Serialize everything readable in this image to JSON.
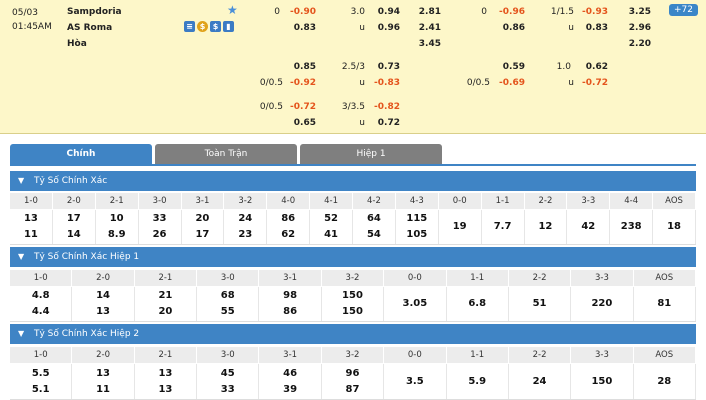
{
  "match": {
    "date": "05/03",
    "time": "01:45AM",
    "home": "Sampdoria",
    "away": "AS Roma",
    "draw": "Hòa",
    "badge": "+72",
    "icons": [
      "stats-icon",
      "coin-icon",
      "dollar-icon",
      "chart-icon"
    ]
  },
  "odds": {
    "ft": {
      "row1": {
        "hc": "0",
        "hc_home": "-0.90",
        "hc_away": "0.83",
        "ou": "3.0",
        "ou_over": "0.94",
        "ou_u": "u",
        "ou_under": "0.96",
        "x_home": "2.81",
        "x_away": "2.41",
        "x_draw": "3.45"
      },
      "row2": {
        "hc_home": "0.85",
        "hc": "0/0.5",
        "hc_away": "-0.92",
        "ou": "2.5/3",
        "ou_over": "0.73",
        "ou_u": "u",
        "ou_under": "-0.83"
      },
      "row3": {
        "hc": "0/0.5",
        "hc_home": "-0.72",
        "hc_away": "0.65",
        "ou": "3/3.5",
        "ou_over": "-0.82",
        "ou_u": "u",
        "ou_under": "0.72"
      }
    },
    "h1": {
      "row1": {
        "hc": "0",
        "hc_home": "-0.96",
        "hc_away": "0.86",
        "ou": "1/1.5",
        "ou_over": "-0.93",
        "ou_u": "u",
        "ou_under": "0.83",
        "x_home": "3.25",
        "x_away": "2.96",
        "x_draw": "2.20"
      },
      "row2": {
        "hc_home": "0.59",
        "hc": "0/0.5",
        "hc_away": "-0.69",
        "ou": "1.0",
        "ou_over": "0.62",
        "ou_u": "u",
        "ou_under": "-0.72"
      }
    }
  },
  "tabs": [
    "Chính",
    "Toàn Trận",
    "Hiệp 1"
  ],
  "sections": [
    {
      "title": "Tỷ Số Chính Xác",
      "headers": [
        "1-0",
        "2-0",
        "2-1",
        "3-0",
        "3-1",
        "3-2",
        "4-0",
        "4-1",
        "4-2",
        "4-3",
        "0-0",
        "1-1",
        "2-2",
        "3-3",
        "4-4",
        "AOS"
      ],
      "values": [
        [
          "13",
          "11"
        ],
        [
          "17",
          "14"
        ],
        [
          "10",
          "8.9"
        ],
        [
          "33",
          "26"
        ],
        [
          "20",
          "17"
        ],
        [
          "24",
          "23"
        ],
        [
          "86",
          "62"
        ],
        [
          "52",
          "41"
        ],
        [
          "64",
          "54"
        ],
        [
          "115",
          "105"
        ],
        [
          "19"
        ],
        [
          "7.7"
        ],
        [
          "12"
        ],
        [
          "42"
        ],
        [
          "238"
        ],
        [
          "18"
        ]
      ]
    },
    {
      "title": "Tỷ Số Chính Xác Hiệp 1",
      "headers": [
        "1-0",
        "2-0",
        "2-1",
        "3-0",
        "3-1",
        "3-2",
        "0-0",
        "1-1",
        "2-2",
        "3-3",
        "AOS"
      ],
      "values": [
        [
          "4.8",
          "4.4"
        ],
        [
          "14",
          "13"
        ],
        [
          "21",
          "20"
        ],
        [
          "68",
          "55"
        ],
        [
          "98",
          "86"
        ],
        [
          "150",
          "150"
        ],
        [
          "3.05"
        ],
        [
          "6.8"
        ],
        [
          "51"
        ],
        [
          "220"
        ],
        [
          "81"
        ]
      ]
    },
    {
      "title": "Tỷ Số Chính Xác Hiệp 2",
      "headers": [
        "1-0",
        "2-0",
        "2-1",
        "3-0",
        "3-1",
        "3-2",
        "0-0",
        "1-1",
        "2-2",
        "3-3",
        "AOS"
      ],
      "values": [
        [
          "5.5",
          "5.1"
        ],
        [
          "13",
          "11"
        ],
        [
          "13",
          "13"
        ],
        [
          "45",
          "33"
        ],
        [
          "46",
          "39"
        ],
        [
          "96",
          "87"
        ],
        [
          "3.5"
        ],
        [
          "5.9"
        ],
        [
          "24"
        ],
        [
          "150"
        ],
        [
          "28"
        ]
      ]
    }
  ]
}
